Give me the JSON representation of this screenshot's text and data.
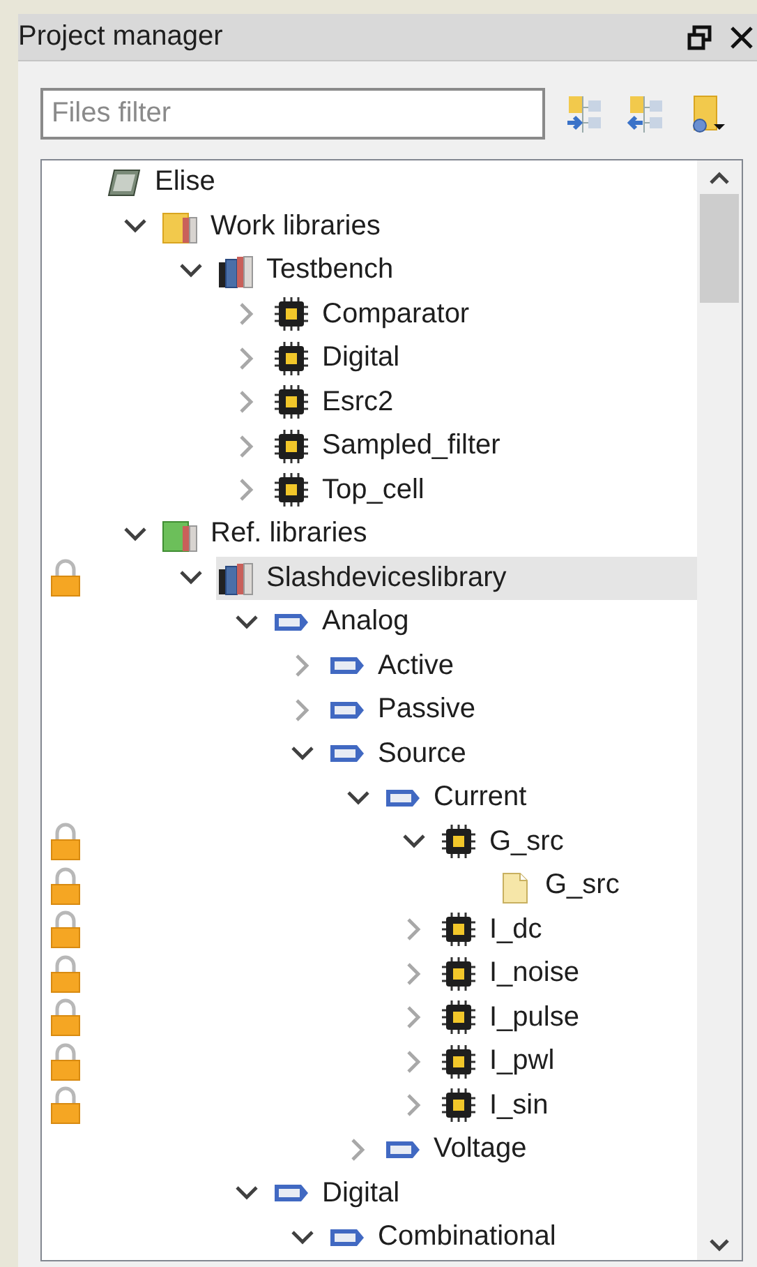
{
  "panel": {
    "title": "Project manager"
  },
  "filter": {
    "placeholder": "Files filter"
  },
  "tree": [
    {
      "name": "Elise",
      "kind": "computer",
      "locked": false,
      "selected": false,
      "children": [
        {
          "name": "Work libraries",
          "kind": "folder-yellow",
          "expanded": true,
          "locked": false,
          "selected": false,
          "children": [
            {
              "name": "Testbench",
              "kind": "books",
              "expanded": true,
              "locked": false,
              "selected": false,
              "children": [
                {
                  "name": "Comparator",
                  "kind": "chip",
                  "expanded": false,
                  "locked": false,
                  "selected": false
                },
                {
                  "name": "Digital",
                  "kind": "chip",
                  "expanded": false,
                  "locked": false,
                  "selected": false
                },
                {
                  "name": "Esrc2",
                  "kind": "chip",
                  "expanded": false,
                  "locked": false,
                  "selected": false
                },
                {
                  "name": "Sampled_filter",
                  "kind": "chip",
                  "expanded": false,
                  "locked": false,
                  "selected": false
                },
                {
                  "name": "Top_cell",
                  "kind": "chip",
                  "expanded": false,
                  "locked": false,
                  "selected": false
                }
              ]
            }
          ]
        },
        {
          "name": "Ref. libraries",
          "kind": "folder-green",
          "expanded": true,
          "locked": false,
          "selected": false,
          "children": [
            {
              "name": "Slashdeviceslibrary",
              "kind": "books",
              "expanded": true,
              "locked": true,
              "selected": true,
              "children": [
                {
                  "name": "Analog",
                  "kind": "tag",
                  "expanded": true,
                  "locked": false,
                  "selected": false,
                  "children": [
                    {
                      "name": "Active",
                      "kind": "tag",
                      "expanded": false,
                      "locked": false,
                      "selected": false
                    },
                    {
                      "name": "Passive",
                      "kind": "tag",
                      "expanded": false,
                      "locked": false,
                      "selected": false
                    },
                    {
                      "name": "Source",
                      "kind": "tag",
                      "expanded": true,
                      "locked": false,
                      "selected": false,
                      "children": [
                        {
                          "name": "Current",
                          "kind": "tag",
                          "expanded": true,
                          "locked": false,
                          "selected": false,
                          "children": [
                            {
                              "name": "G_src",
                              "kind": "chip",
                              "expanded": true,
                              "locked": true,
                              "selected": false,
                              "children": [
                                {
                                  "name": "G_src",
                                  "kind": "file",
                                  "locked": true,
                                  "selected": false
                                }
                              ]
                            },
                            {
                              "name": "I_dc",
                              "kind": "chip",
                              "expanded": false,
                              "locked": true,
                              "selected": false
                            },
                            {
                              "name": "I_noise",
                              "kind": "chip",
                              "expanded": false,
                              "locked": true,
                              "selected": false
                            },
                            {
                              "name": "I_pulse",
                              "kind": "chip",
                              "expanded": false,
                              "locked": true,
                              "selected": false
                            },
                            {
                              "name": "I_pwl",
                              "kind": "chip",
                              "expanded": false,
                              "locked": true,
                              "selected": false
                            },
                            {
                              "name": "I_sin",
                              "kind": "chip",
                              "expanded": false,
                              "locked": true,
                              "selected": false
                            }
                          ]
                        },
                        {
                          "name": "Voltage",
                          "kind": "tag",
                          "expanded": false,
                          "locked": false,
                          "selected": false
                        }
                      ]
                    }
                  ]
                },
                {
                  "name": "Digital",
                  "kind": "tag",
                  "expanded": true,
                  "locked": false,
                  "selected": false,
                  "children": [
                    {
                      "name": "Combinational",
                      "kind": "tag",
                      "expanded": true,
                      "locked": false,
                      "selected": false
                    }
                  ]
                }
              ]
            }
          ]
        }
      ]
    }
  ]
}
